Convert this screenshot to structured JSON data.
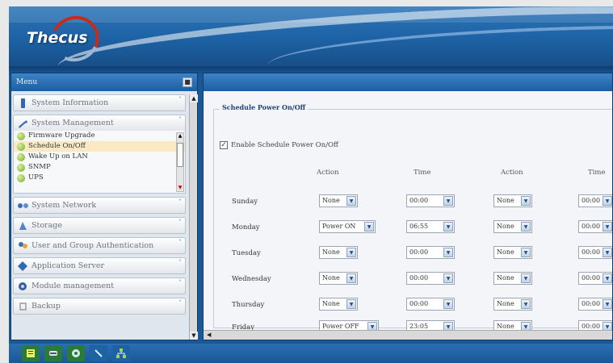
{
  "header": {
    "logo_text": "Thecus"
  },
  "menu": {
    "title": "Menu",
    "collapse_icon": "collapse-icon",
    "categories": [
      {
        "label": "System Information",
        "icon": "info-icon"
      },
      {
        "label": "System Management",
        "icon": "wrench-icon",
        "items": [
          "Firmware Upgrade",
          "Schedule On/Off",
          "Wake Up on LAN",
          "SNMP",
          "UPS"
        ],
        "selected": "Schedule On/Off"
      },
      {
        "label": "System Network",
        "icon": "network-icon"
      },
      {
        "label": "Storage",
        "icon": "storage-icon"
      },
      {
        "label": "User and Group Authentication",
        "icon": "users-icon"
      },
      {
        "label": "Application Server",
        "icon": "application-icon"
      },
      {
        "label": "Module management",
        "icon": "module-icon"
      },
      {
        "label": "Backup",
        "icon": "backup-icon"
      }
    ]
  },
  "schedule": {
    "legend": "Schedule Power On/Off",
    "enable_label": "Enable Schedule Power On/Off",
    "enabled": true,
    "columns": [
      "Action",
      "Time",
      "Action",
      "Time"
    ],
    "rows": [
      {
        "day": "Sunday",
        "action1": "None",
        "time1": "00:00",
        "action2": "None",
        "time2": "00:00"
      },
      {
        "day": "Monday",
        "action1": "Power ON",
        "time1": "06:55",
        "action2": "None",
        "time2": "00:00"
      },
      {
        "day": "Tuesday",
        "action1": "None",
        "time1": "00:00",
        "action2": "None",
        "time2": "00:00"
      },
      {
        "day": "Wednesday",
        "action1": "None",
        "time1": "00:00",
        "action2": "None",
        "time2": "00:00"
      },
      {
        "day": "Thursday",
        "action1": "None",
        "time1": "00:00",
        "action2": "None",
        "time2": "00:00"
      },
      {
        "day": "Friday",
        "action1": "Power OFF",
        "time1": "23:05",
        "action2": "None",
        "time2": "00:00"
      }
    ]
  },
  "taskbar": {
    "icons": [
      "log-icon",
      "disk-icon",
      "fan-icon",
      "tools-icon",
      "network-status-icon"
    ]
  }
}
